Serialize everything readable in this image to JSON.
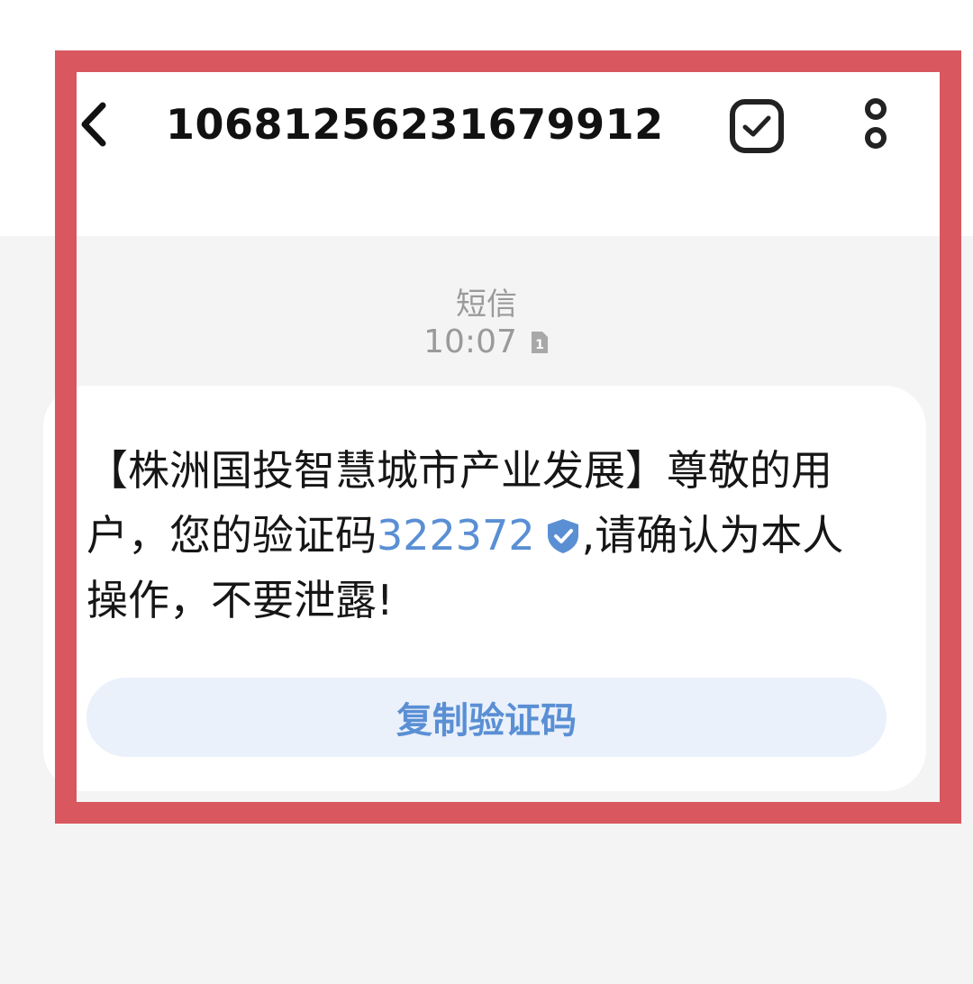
{
  "header": {
    "back_icon": "chevron-left-icon",
    "contact_number": "10681256231679912",
    "select_icon": "checkbox-icon",
    "more_icon": "vertical-dots-icon"
  },
  "conversation": {
    "channel_label": "短信",
    "time": "10:07",
    "sim_indicator": "1"
  },
  "message": {
    "text_before_code": "【株洲国投智慧城市产业发展】尊敬的用户，您的验证码",
    "code": "322372",
    "text_after_code": ",请确认为本人操作，不要泄露!",
    "verified_icon": "verified-shield-icon",
    "copy_button_label": "复制验证码"
  },
  "colors": {
    "accent": "#5a8fd4",
    "highlight_frame": "#d9575e",
    "background": "#f4f4f4"
  }
}
